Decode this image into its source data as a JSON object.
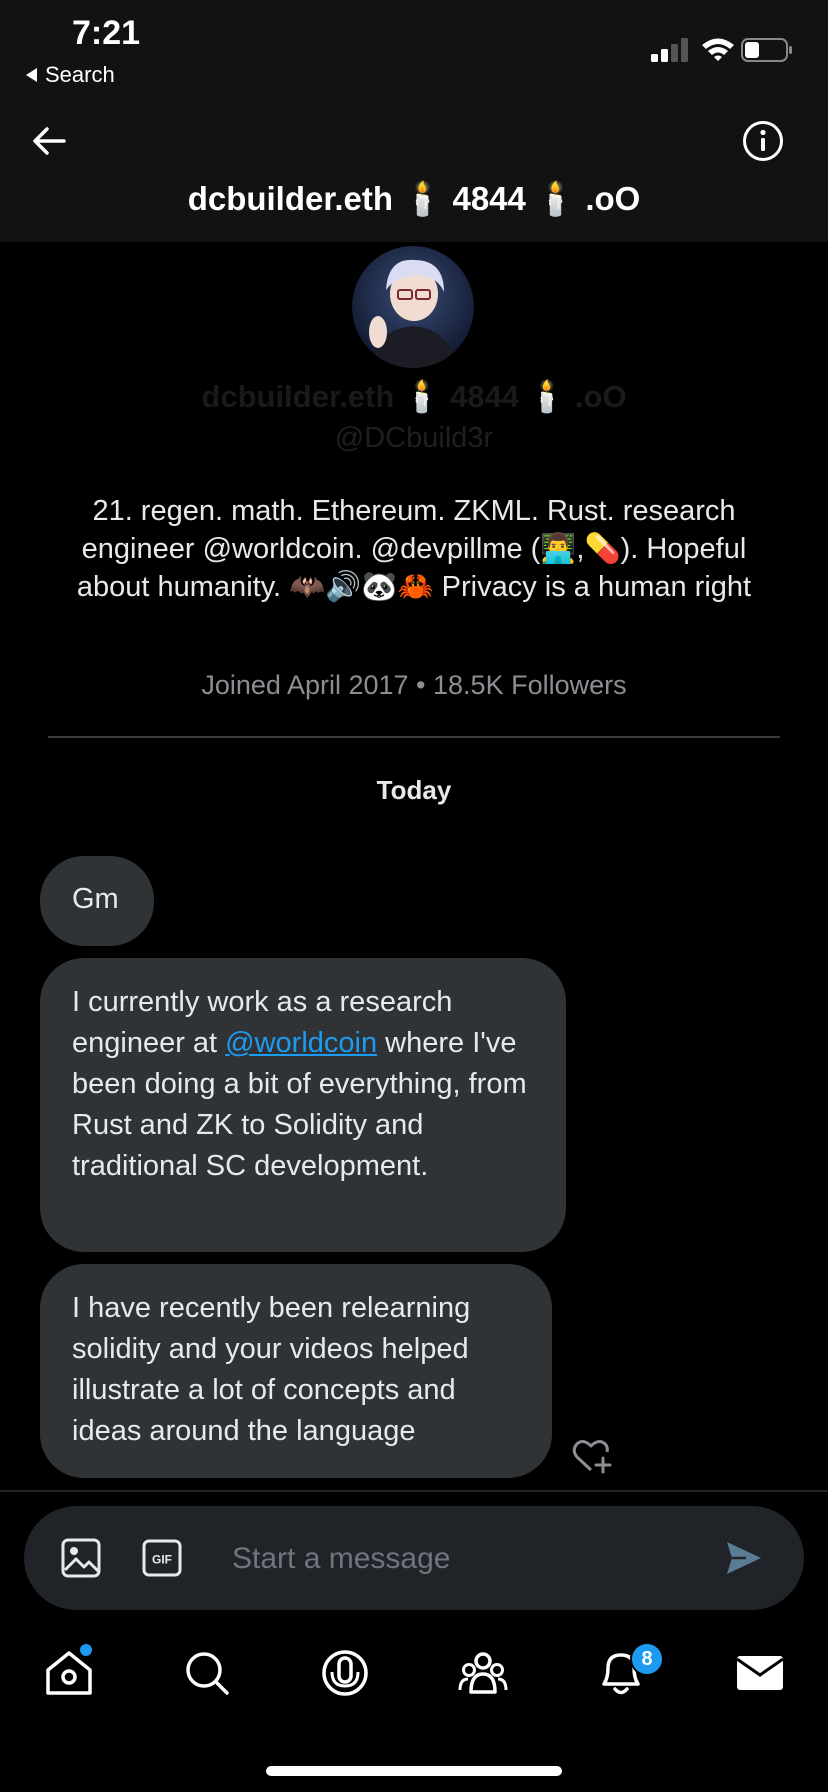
{
  "status_bar": {
    "time": "7:21",
    "back_app": "Search"
  },
  "header": {
    "title": "dcbuilder.eth 🕯️ 4844 🕯️ .oO",
    "icons": {
      "back": "arrow-left-icon",
      "info": "info-icon"
    }
  },
  "profile": {
    "name": "dcbuilder.eth 🕯️ 4844 🕯️ .oO",
    "handle": "@DCbuild3r",
    "bio": "21. regen. math. Ethereum. ZKML. Rust. research engineer @worldcoin. @devpillme (👨‍💻,💊). Hopeful about humanity. 🦇🔊🐼🦀 Privacy is a human right",
    "joined": "Joined April 2017",
    "separator": "•",
    "followers": "18.5K Followers"
  },
  "conversation": {
    "day_label": "Today",
    "messages": [
      {
        "text": "Gm"
      },
      {
        "text_before": "I currently work as a research engineer at ",
        "mention": "@worldcoin",
        "text_after": " where I've been doing a bit of everything, from Rust and ZK to Solidity and traditional SC development."
      },
      {
        "text": "I have recently been relearning solidity and your videos helped illustrate a lot of concepts and ideas around the language"
      }
    ]
  },
  "composer": {
    "placeholder": "Start a message",
    "gif_label": "GIF"
  },
  "tab_bar": {
    "items": [
      "home-icon",
      "search-icon",
      "spaces-icon",
      "communities-icon",
      "notifications-icon",
      "messages-icon"
    ],
    "notification_count": "8"
  },
  "colors": {
    "accent": "#1d9bf0",
    "bubble": "#2f3336",
    "background": "#000000",
    "bar": "#121212"
  }
}
